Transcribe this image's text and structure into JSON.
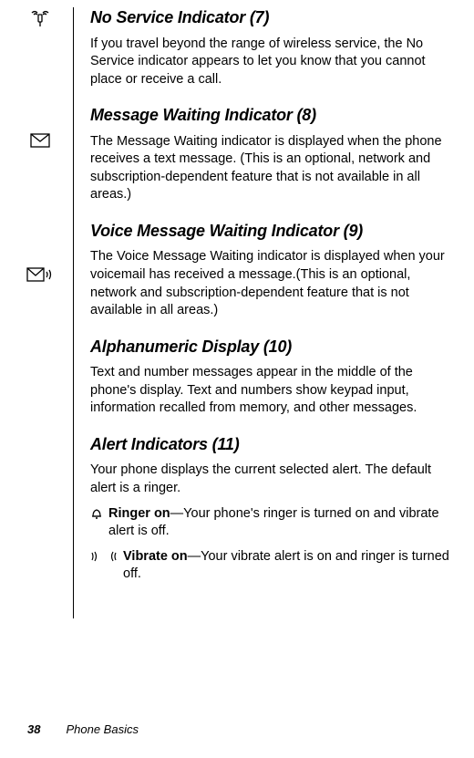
{
  "sections": {
    "noService": {
      "heading": "No Service Indicator (7)",
      "body": "If you travel beyond the range of wireless service, the No Service indicator appears to let you know that you cannot place or receive a call."
    },
    "messageWaiting": {
      "heading": "Message Waiting Indicator (8)",
      "body": "The Message Waiting indicator is displayed when the phone receives a text message. (This is an optional, network and subscription-dependent feature that is not available in all areas.)"
    },
    "voiceMessageWaiting": {
      "heading": "Voice Message Waiting Indicator (9)",
      "body": "The Voice Message Waiting indicator is displayed when your voicemail has received a message.(This is an optional, network and subscription-dependent feature that is not available in all areas.)"
    },
    "alphanumeric": {
      "heading": "Alphanumeric Display (10)",
      "body": "Text and number messages appear in the middle of the phone's display. Text and numbers show keypad input, information recalled from memory, and other messages."
    },
    "alertIndicators": {
      "heading": "Alert Indicators (11)",
      "body": "Your phone displays the current selected alert. The default alert is a ringer.",
      "ringerOn": {
        "label": "Ringer on",
        "text": "—Your phone's ringer is turned on and vibrate alert is off."
      },
      "vibrateOn": {
        "label": "Vibrate on",
        "text": "—Your vibrate alert is on and ringer is turned off."
      }
    }
  },
  "footer": {
    "pageNumber": "38",
    "chapterTitle": "Phone Basics"
  }
}
